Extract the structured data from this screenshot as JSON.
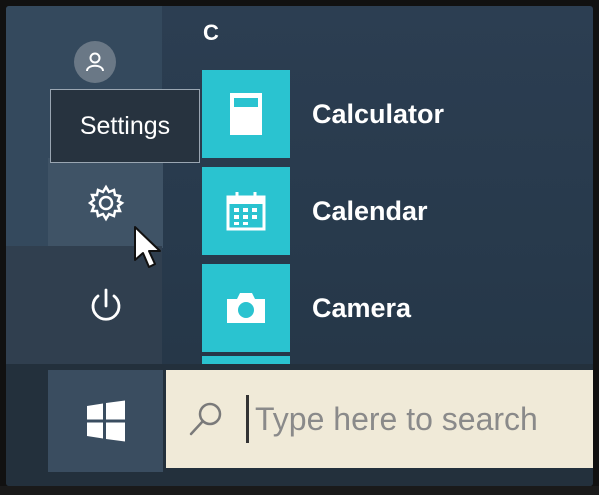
{
  "start_menu": {
    "tooltip": "Settings",
    "section_letter": "C",
    "apps": [
      {
        "label": "Calculator",
        "icon": "calculator-icon"
      },
      {
        "label": "Calendar",
        "icon": "calendar-icon"
      },
      {
        "label": "Camera",
        "icon": "camera-icon"
      }
    ],
    "rail_icons": [
      "user-avatar-icon",
      "gear-icon",
      "power-icon"
    ]
  },
  "taskbar": {
    "start_icon": "windows-logo-icon",
    "search": {
      "placeholder": "Type here to search",
      "icon": "search-icon"
    }
  },
  "colors": {
    "tile_accent": "#2ac3d0",
    "menu_background": "#2c3e52",
    "search_background": "#f0ead8"
  }
}
